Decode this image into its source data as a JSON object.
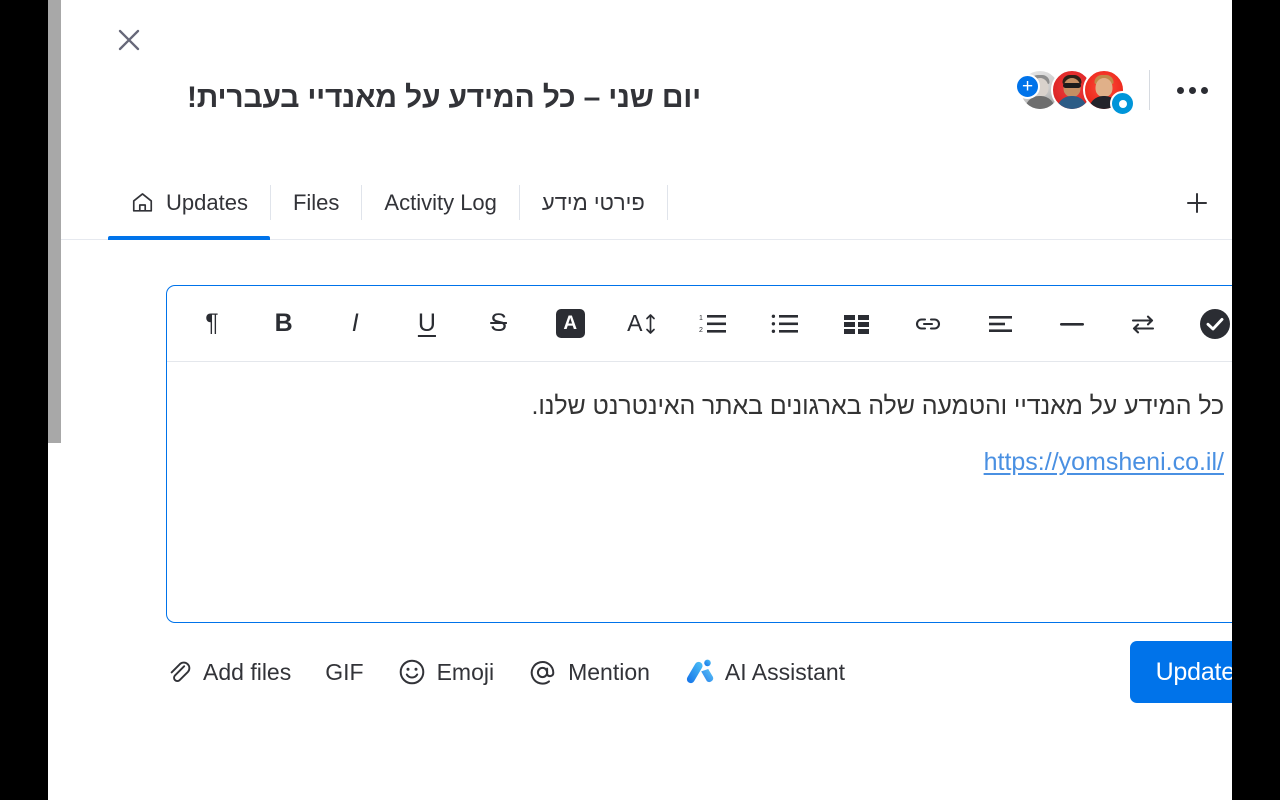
{
  "window": {
    "close_label": "×"
  },
  "header": {
    "title": "יום שני – כל המידע על מאנדיי בעברית!",
    "add_member_badge": "+",
    "watch_badge_icon": "eye-icon",
    "more_menu_icon": "more-horizontal-icon",
    "avatars": [
      {
        "name": "avatar-1",
        "style": "grayscale"
      },
      {
        "name": "avatar-2",
        "style": "red"
      },
      {
        "name": "avatar-3",
        "style": "red"
      }
    ]
  },
  "tabs": {
    "items": [
      {
        "label": "Updates",
        "icon": "home-icon",
        "active": true
      },
      {
        "label": "Files",
        "icon": "",
        "active": false
      },
      {
        "label": "Activity Log",
        "icon": "",
        "active": false
      },
      {
        "label": "פירטי מידע",
        "icon": "",
        "active": false,
        "rtl": true
      }
    ],
    "add_tab_label": "+",
    "add_tab_icon": "plus-icon"
  },
  "editor": {
    "toolbar": [
      {
        "name": "paragraph-style-button",
        "icon": "pilcrow-icon",
        "glyph": "¶"
      },
      {
        "name": "bold-button",
        "icon": "bold-icon",
        "glyph": "B"
      },
      {
        "name": "italic-button",
        "icon": "italic-icon",
        "glyph": "I"
      },
      {
        "name": "underline-button",
        "icon": "underline-icon",
        "glyph": "U"
      },
      {
        "name": "strikethrough-button",
        "icon": "strikethrough-icon",
        "glyph": "S"
      },
      {
        "name": "text-color-button",
        "icon": "text-color-icon",
        "glyph": "A"
      },
      {
        "name": "font-size-button",
        "icon": "font-size-icon",
        "glyph": "A"
      },
      {
        "name": "numbered-list-button",
        "icon": "numbered-list-icon",
        "glyph": ""
      },
      {
        "name": "bullet-list-button",
        "icon": "bullet-list-icon",
        "glyph": ""
      },
      {
        "name": "table-button",
        "icon": "table-icon",
        "glyph": ""
      },
      {
        "name": "link-button",
        "icon": "link-icon",
        "glyph": ""
      },
      {
        "name": "align-button",
        "icon": "align-left-icon",
        "glyph": ""
      },
      {
        "name": "horizontal-rule-button",
        "icon": "horizontal-rule-icon",
        "glyph": ""
      },
      {
        "name": "text-direction-button",
        "icon": "text-direction-icon",
        "glyph": ""
      },
      {
        "name": "checkmark-button",
        "icon": "check-circle-filled-icon",
        "glyph": ""
      }
    ],
    "body_text": "כל המידע על מאנדיי והטמעה שלה בארגונים באתר האינטרנט שלנו.",
    "link_text": "https://yomsheni.co.il/"
  },
  "actions": {
    "add_files": {
      "label": "Add files",
      "icon": "paperclip-icon"
    },
    "gif": {
      "label": "GIF",
      "icon": ""
    },
    "emoji": {
      "label": "Emoji",
      "icon": "smiley-icon"
    },
    "mention": {
      "label": "Mention",
      "icon": "at-icon"
    },
    "ai_assistant": {
      "label": "AI Assistant",
      "icon": "ai-sparkle-icon"
    },
    "update_button": "Update"
  },
  "colors": {
    "accent_blue": "#0073ea",
    "link_blue": "#4a90e2",
    "text_dark": "#323338",
    "border_light": "#e6e9ef",
    "scrollbar": "#a8a8a8"
  }
}
